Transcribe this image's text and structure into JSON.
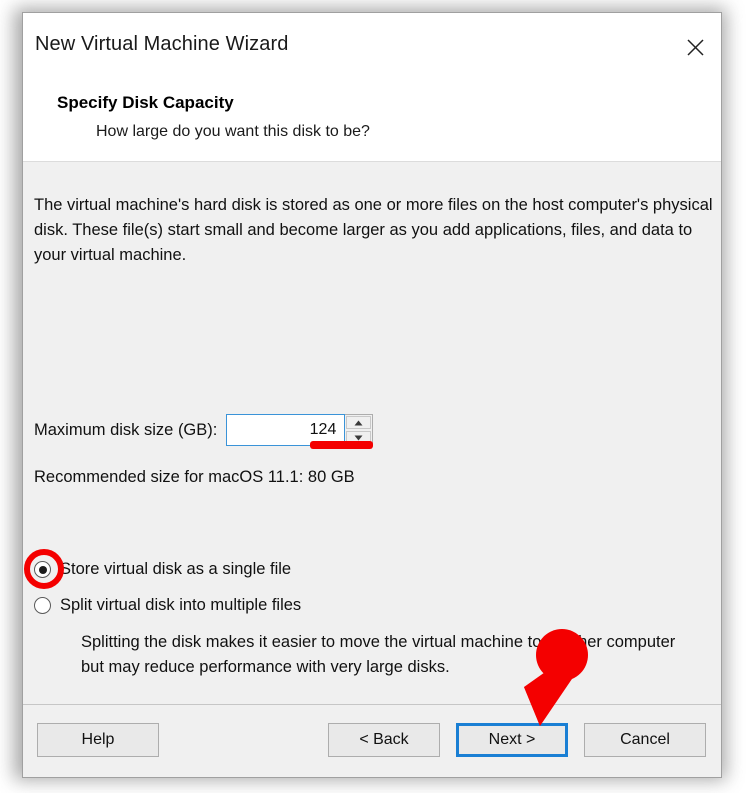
{
  "window": {
    "title": "New Virtual Machine Wizard",
    "close_icon": "close-icon"
  },
  "header": {
    "heading": "Specify Disk Capacity",
    "subheading": "How large do you want this disk to be?"
  },
  "body": {
    "description": "The virtual machine's hard disk is stored as one or more files on the host computer's physical disk. These file(s) start small and become larger as you add applications, files, and data to your virtual machine.",
    "disk_size_label": "Maximum disk size (GB):",
    "disk_size_value": "124",
    "spin_up_icon": "triangle-up-icon",
    "spin_down_icon": "triangle-down-icon",
    "recommended": "Recommended size for macOS 11.1: 80 GB",
    "radios": [
      {
        "label": "Store virtual disk as a single file",
        "checked": true
      },
      {
        "label": "Split virtual disk into multiple files",
        "checked": false
      }
    ],
    "split_note": "Splitting the disk makes it easier to move the virtual machine to another computer but may reduce performance with very large disks."
  },
  "footer": {
    "help": "Help",
    "back": "< Back",
    "next": "Next >",
    "cancel": "Cancel"
  },
  "annotations": {
    "accent_color": "#f40000",
    "focus_color": "#1a7fd4",
    "input_border_color": "#3a93d8",
    "arrow_icon": "red-arrow-pointing-to-next-button",
    "ring_icon": "red-circle-highlight-on-selected-radio",
    "underline_icon": "red-underline-on-disk-size-field"
  }
}
